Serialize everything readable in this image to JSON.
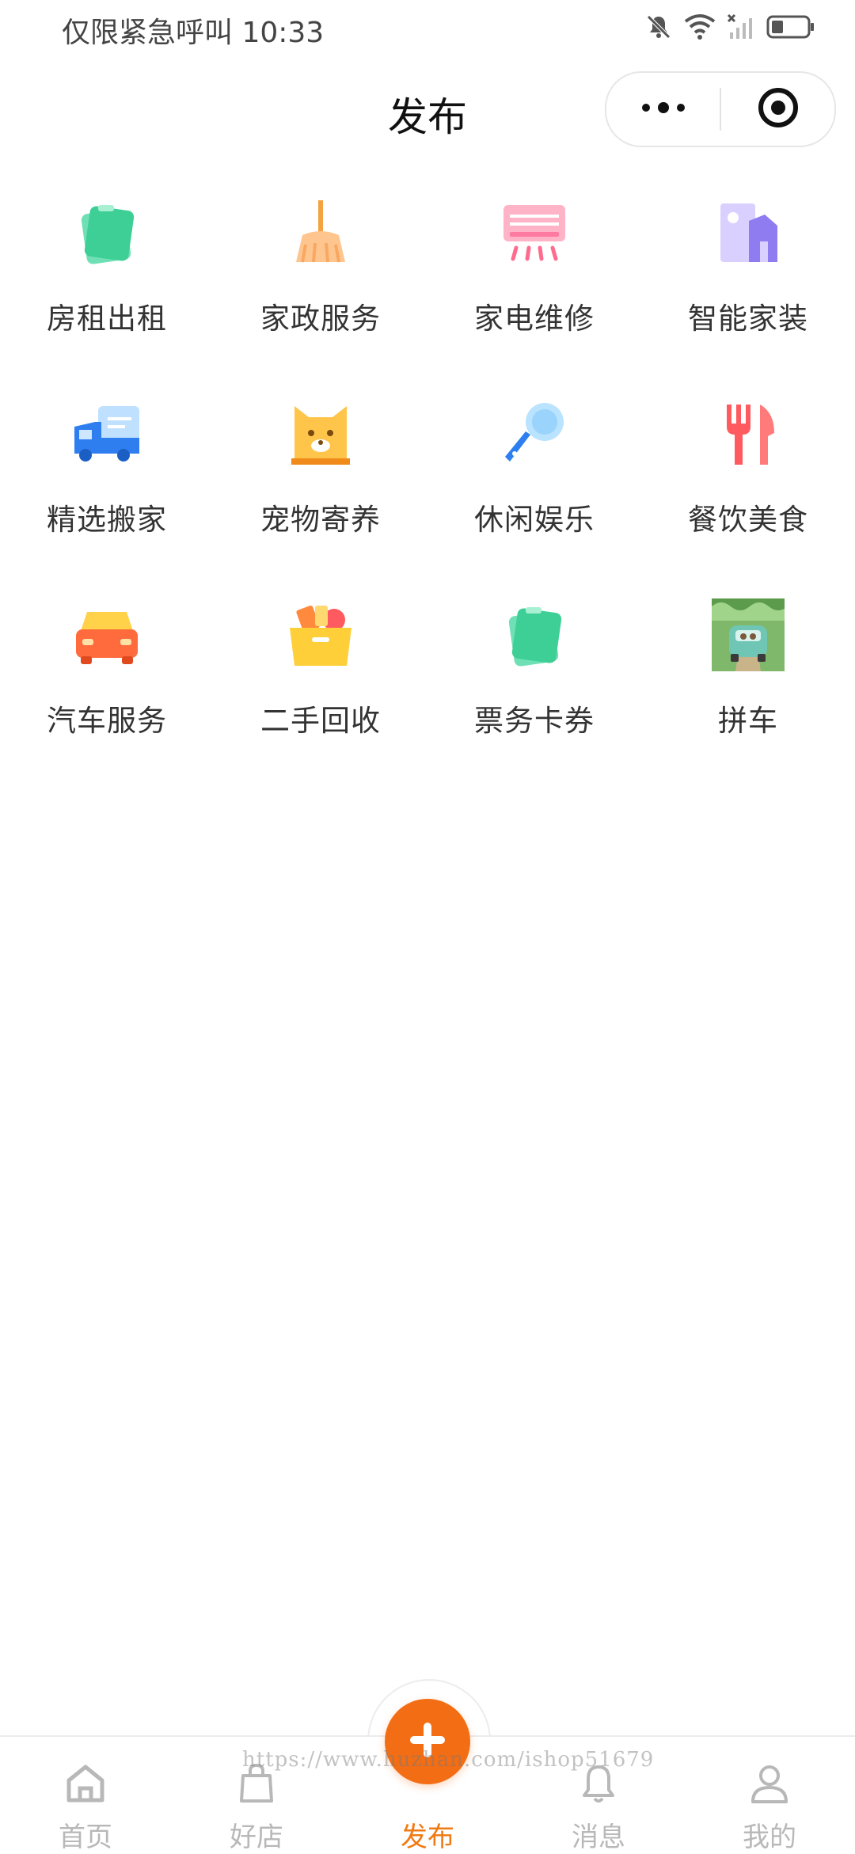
{
  "status_bar": {
    "left_text": "仅限紧急呼叫 10:33",
    "icons": [
      "bell-off-icon",
      "wifi-icon",
      "signal-off-icon",
      "battery-icon"
    ]
  },
  "navbar": {
    "title": "发布",
    "capsule_icons": [
      "more-dots-icon",
      "close-target-icon"
    ]
  },
  "categories": [
    {
      "label": "房租出租",
      "icon": "house-rent-icon"
    },
    {
      "label": "家政服务",
      "icon": "broom-icon"
    },
    {
      "label": "家电维修",
      "icon": "air-conditioner-icon"
    },
    {
      "label": "智能家装",
      "icon": "smart-home-icon"
    },
    {
      "label": "精选搬家",
      "icon": "moving-truck-icon"
    },
    {
      "label": "宠物寄养",
      "icon": "pet-icon"
    },
    {
      "label": "休闲娱乐",
      "icon": "microphone-icon"
    },
    {
      "label": "餐饮美食",
      "icon": "fork-knife-icon"
    },
    {
      "label": "汽车服务",
      "icon": "car-icon"
    },
    {
      "label": "二手回收",
      "icon": "recycle-box-icon"
    },
    {
      "label": "票务卡券",
      "icon": "ticket-icon"
    },
    {
      "label": "拼车",
      "icon": "carpool-image-icon"
    }
  ],
  "tabbar": {
    "items": [
      {
        "label": "首页",
        "icon": "home-icon",
        "active": false
      },
      {
        "label": "好店",
        "icon": "shop-bag-icon",
        "active": false
      },
      {
        "label": "发布",
        "icon": "plus-icon",
        "active": true
      },
      {
        "label": "消息",
        "icon": "bell-icon",
        "active": false
      },
      {
        "label": "我的",
        "icon": "user-icon",
        "active": false
      }
    ],
    "watermark": "https://www.huzhan.com/ishop51679"
  },
  "colors": {
    "accent": "#f36d14",
    "active_tab_label": "#f07a13",
    "inactive_tab": "#b8b8b8"
  }
}
